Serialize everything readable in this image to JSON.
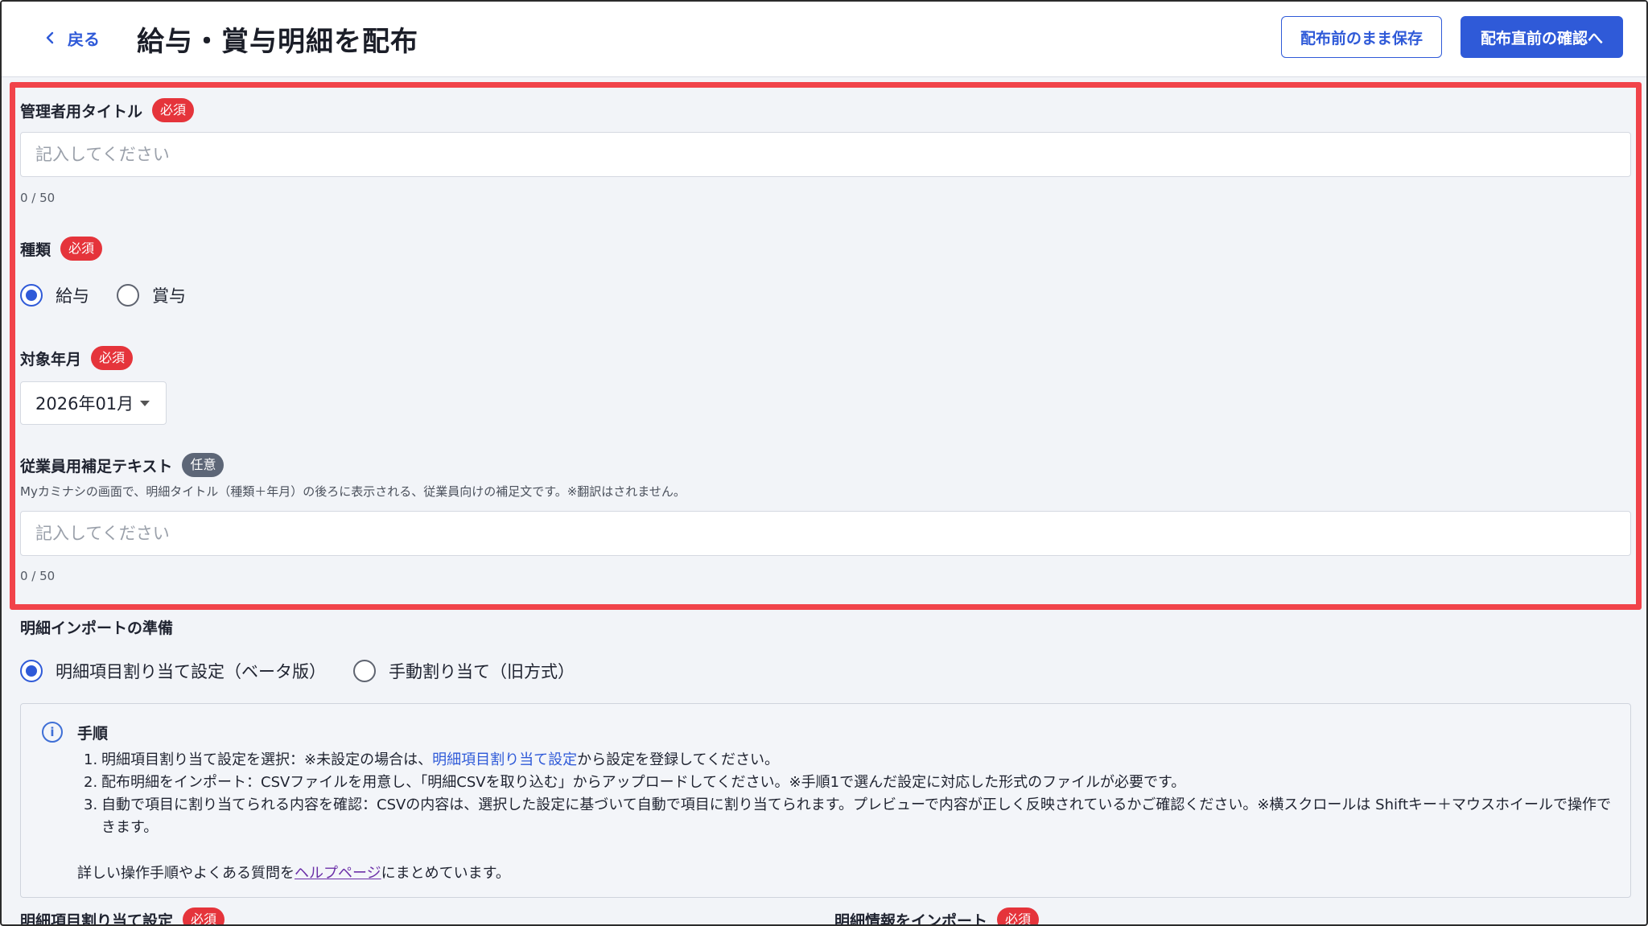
{
  "header": {
    "back_label": "戻る",
    "title": "給与・賞与明細を配布",
    "save_draft_label": "配布前のまま保存",
    "confirm_label": "配布直前の確認へ"
  },
  "admin_title": {
    "label": "管理者用タイトル",
    "badge": "必須",
    "placeholder": "記入してください",
    "counter": "0 / 50"
  },
  "type": {
    "label": "種類",
    "badge": "必須",
    "options": [
      {
        "label": "給与",
        "selected": true
      },
      {
        "label": "賞与",
        "selected": false
      }
    ]
  },
  "period": {
    "label": "対象年月",
    "badge": "必須",
    "value": "2026年01月"
  },
  "employee_text": {
    "label": "従業員用補足テキスト",
    "badge": "任意",
    "help": "Myカミナシの画面で、明細タイトル（種類＋年月）の後ろに表示される、従業員向けの補足文です。※翻訳はされません。",
    "placeholder": "記入してください",
    "counter": "0 / 50"
  },
  "import_prep": {
    "label": "明細インポートの準備",
    "options": [
      {
        "label": "明細項目割り当て設定（ベータ版）",
        "selected": true
      },
      {
        "label": "手動割り当て（旧方式）",
        "selected": false
      }
    ]
  },
  "procedure": {
    "title": "手順",
    "step1_num": "1.",
    "step1_pre": "明細項目割り当て設定を選択：※未設定の場合は、",
    "step1_link": "明細項目割り当て設定",
    "step1_post": "から設定を登録してください。",
    "step2_num": "2.",
    "step2": "配布明細をインポート：CSVファイルを用意し、「明細CSVを取り込む」からアップロードしてください。※手順1で選んだ設定に対応した形式のファイルが必要です。",
    "step3_num": "3.",
    "step3": "自動で項目に割り当てられる内容を確認：CSVの内容は、選択した設定に基づいて自動で項目に割り当てられます。プレビューで内容が正しく反映されているかご確認ください。※横スクロールは Shiftキー＋マウスホイールで操作できます。",
    "foot_pre": "詳しい操作手順やよくある質問を",
    "foot_link": "ヘルプページ",
    "foot_post": "にまとめています。"
  },
  "bottom": {
    "left_label": "明細項目割り当て設定",
    "left_badge": "必須",
    "right_label": "明細情報をインポート",
    "right_badge": "必須"
  },
  "colors": {
    "accent": "#2f5ad8",
    "required": "#e5343b",
    "highlight": "#f1434a"
  }
}
